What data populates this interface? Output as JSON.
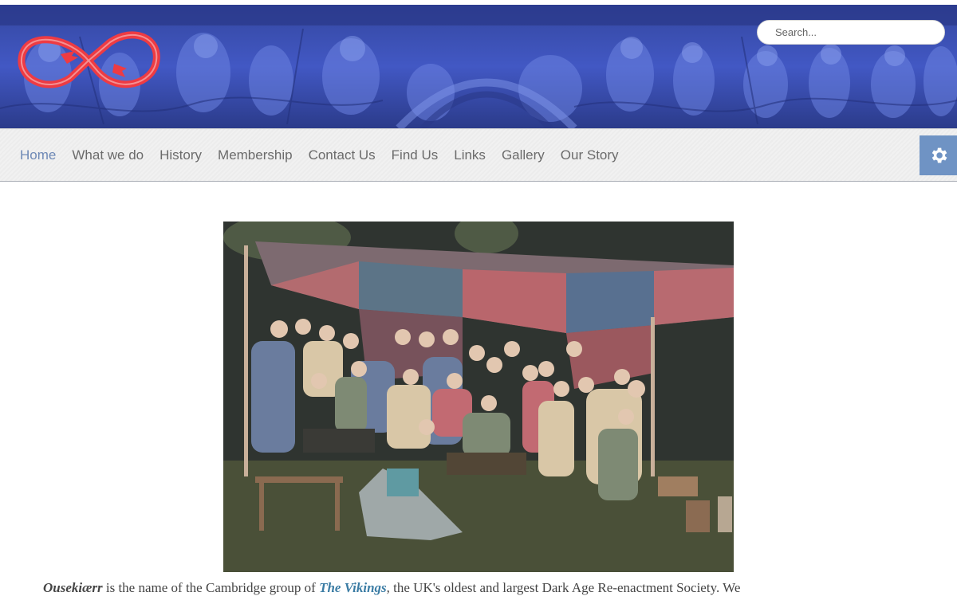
{
  "header": {
    "search_placeholder": "Search...",
    "colors": {
      "banner": "#3b4fb0",
      "logo": "#ee3b43",
      "accent": "#6f93c4"
    }
  },
  "nav": {
    "items": [
      {
        "label": "Home",
        "active": true
      },
      {
        "label": "What we do"
      },
      {
        "label": "History"
      },
      {
        "label": "Membership"
      },
      {
        "label": "Contact Us"
      },
      {
        "label": "Find Us"
      },
      {
        "label": "Links"
      },
      {
        "label": "Gallery"
      },
      {
        "label": "Our Story"
      }
    ],
    "settings_icon": "gear-icon"
  },
  "main": {
    "intro": {
      "name": "Ousekiærr",
      "part1": " is the name of the Cambridge group of ",
      "link": "The Vikings",
      "part2": ", the UK's oldest and largest Dark Age Re-enactment Society. We"
    }
  }
}
